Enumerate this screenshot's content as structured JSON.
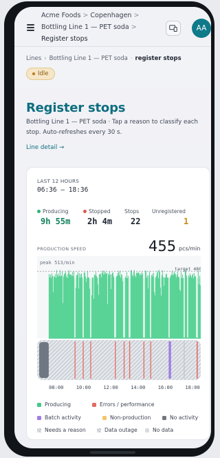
{
  "header": {
    "breadcrumb": [
      "Acme Foods",
      "Copenhagen",
      "Bottling Line 1 — PET soda",
      "Register stops"
    ],
    "avatar_initials": "AA",
    "device_icon": "device-switch-icon"
  },
  "subcrumb": {
    "items": [
      "Lines",
      "Bottling Line 1 — PET soda",
      "register stops"
    ]
  },
  "status_badge": {
    "label": "Idle",
    "color": "#b9781c"
  },
  "page": {
    "title": "Register stops",
    "description": "Bottling Line 1 — PET soda · Tap a reason to classify each stop. Auto-refreshes every 30 s.",
    "line_detail_link": "Line detail →"
  },
  "summary": {
    "period_label": "LAST 12 HOURS",
    "time_range": "06:36 – 18:36",
    "stats": [
      {
        "label": "Producing",
        "value": "9h 55m",
        "color": "#2bb673"
      },
      {
        "label": "Stopped",
        "value": "2h 4m",
        "color": "#e2574c"
      },
      {
        "label": "Stops",
        "value": "22",
        "color": ""
      },
      {
        "label": "Unregistered",
        "value": "1",
        "color": "#c98a10"
      }
    ]
  },
  "speed": {
    "label": "PRODUCTION SPEED",
    "value": "455",
    "unit": "pcs/min",
    "peak_label": "peak 513/min",
    "target_label": "target 480"
  },
  "chart_data": {
    "type": "area",
    "title": "PRODUCTION SPEED",
    "xlabel": "",
    "ylabel": "pcs/min",
    "x_ticks": [
      "08:00",
      "10:00",
      "12:00",
      "14:00",
      "16:00",
      "18:00"
    ],
    "xlim_hours": [
      6.6,
      18.6
    ],
    "ylim": [
      0,
      540
    ],
    "peak": 513,
    "target": 480,
    "production_start_hour": 7.45,
    "stops_hours": [
      9.35,
      9.95,
      10.5,
      12.3,
      12.95,
      13.35,
      14.4,
      14.9,
      16.25,
      17.35,
      17.6,
      18.3
    ],
    "series": [
      {
        "name": "Producing",
        "typical_value": 460
      }
    ]
  },
  "timeline": {
    "segments": [
      {
        "kind": "no_activity",
        "start": 6.6,
        "end": 7.45
      },
      {
        "kind": "error",
        "start": 9.35,
        "end": 9.4
      },
      {
        "kind": "error",
        "start": 9.95,
        "end": 10.0
      },
      {
        "kind": "error",
        "start": 10.5,
        "end": 10.55
      },
      {
        "kind": "error",
        "start": 12.3,
        "end": 12.35
      },
      {
        "kind": "error",
        "start": 12.95,
        "end": 13.0
      },
      {
        "kind": "error",
        "start": 13.35,
        "end": 13.42
      },
      {
        "kind": "error",
        "start": 14.4,
        "end": 14.45
      },
      {
        "kind": "error",
        "start": 14.9,
        "end": 14.96
      },
      {
        "kind": "batch",
        "start": 16.25,
        "end": 16.42
      },
      {
        "kind": "needs_reason",
        "start": 17.35,
        "end": 17.42
      },
      {
        "kind": "error",
        "start": 18.3,
        "end": 18.38
      }
    ]
  },
  "legend": [
    {
      "label": "Producing",
      "color": "#43c98a",
      "icon": "swatch"
    },
    {
      "label": "Errors / performance",
      "color": "#e46b62",
      "icon": "swatch"
    },
    {
      "label": "Batch activity",
      "color": "#a07de6",
      "icon": "swatch"
    },
    {
      "label": "Non-production",
      "color": "#f4c56a",
      "icon": "swatch"
    },
    {
      "label": "No activity",
      "color": "#6f7782",
      "icon": "swatch"
    },
    {
      "label": "Needs a reason",
      "color": "#b9bec7",
      "icon": "hatch"
    },
    {
      "label": "Data outage",
      "color": "#b9bec7",
      "icon": "hatch"
    },
    {
      "label": "No data",
      "color": "#d8dbe0",
      "icon": "swatch"
    }
  ]
}
